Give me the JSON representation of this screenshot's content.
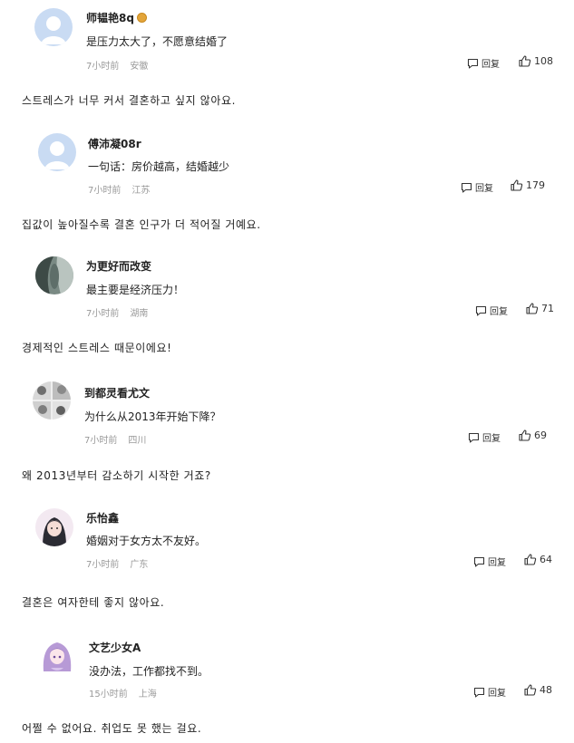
{
  "icons": {
    "reply": "comment-bubble-icon",
    "like": "thumbs-up-icon",
    "badge": "medal-badge-icon"
  },
  "colors": {
    "meta": "#999999",
    "text": "#222222",
    "badge": "#e3a53a"
  },
  "comments": [
    {
      "user": "师韫艳8q",
      "text": "是压力太大了，不愿意结婚了",
      "time": "7小时前",
      "location": "安徽",
      "reply_label": "回复",
      "likes": "108",
      "translation": "스트레스가 너무 커서 결혼하고 싶지 않아요."
    },
    {
      "user": "傅沛凝08r",
      "text": "一句话：房价越高，结婚越少",
      "time": "7小时前",
      "location": "江苏",
      "reply_label": "回复",
      "likes": "179",
      "translation": "집값이 높아질수록 결혼 인구가 더 적어질 거예요."
    },
    {
      "user": "为更好而改变",
      "text": "最主要是经济压力！",
      "time": "7小时前",
      "location": "湖南",
      "reply_label": "回复",
      "likes": "71",
      "translation": "경제적인 스트레스 때문이에요!"
    },
    {
      "user": "到都灵看尤文",
      "text": "为什么从2013年开始下降？",
      "time": "7小时前",
      "location": "四川",
      "reply_label": "回复",
      "likes": "69",
      "translation": "왜 2013년부터 감소하기 시작한 거죠?"
    },
    {
      "user": "乐怡鑫",
      "text": "婚姻对于女方太不友好。",
      "time": "7小时前",
      "location": "广东",
      "reply_label": "回复",
      "likes": "64",
      "translation": "결혼은 여자한테 좋지 않아요."
    },
    {
      "user": "文艺少女A",
      "text": "没办法，工作都找不到。",
      "time": "15小时前",
      "location": "上海",
      "reply_label": "回复",
      "likes": "48",
      "translation": "어쩔 수 없어요. 취업도 못 했는 걸요."
    }
  ]
}
